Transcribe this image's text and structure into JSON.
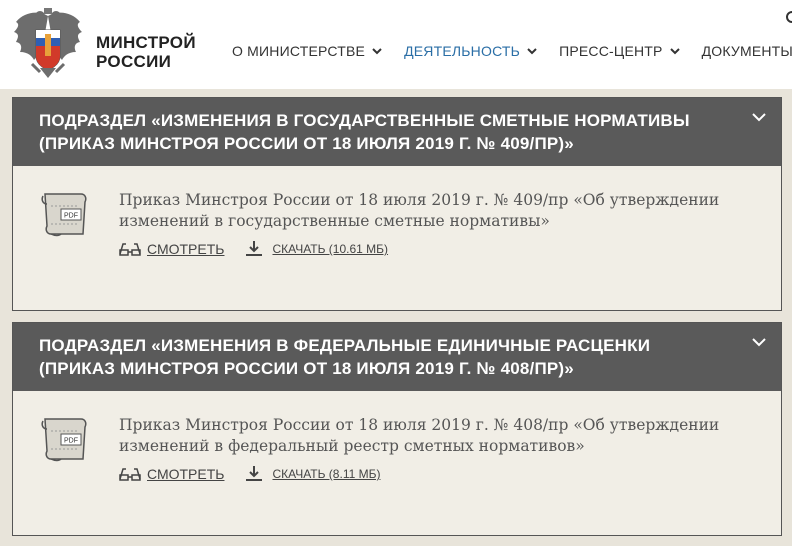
{
  "header": {
    "brand_line1": "МИНСТРОЙ",
    "brand_line2": "РОССИИ",
    "nav": [
      {
        "label": "О МИНИСТЕРСТВЕ",
        "active": false
      },
      {
        "label": "ДЕЯТЕЛЬНОСТЬ",
        "active": true
      },
      {
        "label": "ПРЕСС-ЦЕНТР",
        "active": false
      },
      {
        "label": "ДОКУМЕНТЫ",
        "active": false
      }
    ]
  },
  "colors": {
    "accent": "#2a6ea6",
    "panel_header": "#5a5a5a",
    "panel_body": "#f1eee6",
    "page_bg": "#e8e4da"
  },
  "panels": [
    {
      "title": "ПОДРАЗДЕЛ «ИЗМЕНЕНИЯ В ГОСУДАРСТВЕННЫЕ СМЕТНЫЕ НОРМАТИВЫ (ПРИКАЗ МИНСТРОЯ РОССИИ ОТ 18 ИЮЛЯ 2019 Г. № 409/ПР)»",
      "doc_title": "Приказ Минстроя России от 18 июля 2019 г. № 409/пр «Об утверждении изменений в государственные сметные нормативы»",
      "view_label": "СМОТРЕТЬ",
      "download_label": "СКАЧАТЬ (10.61 МБ)",
      "icon": "pdf-scroll-icon"
    },
    {
      "title": "ПОДРАЗДЕЛ «ИЗМЕНЕНИЯ В ФЕДЕРАЛЬНЫЕ ЕДИНИЧНЫЕ РАСЦЕНКИ (ПРИКАЗ МИНСТРОЯ РОССИИ ОТ 18 ИЮЛЯ 2019 Г. № 408/ПР)»",
      "doc_title": "Приказ Минстроя России от 18 июля 2019 г. № 408/пр «Об утверждении изменений в федеральный реестр сметных нормативов»",
      "view_label": "СМОТРЕТЬ",
      "download_label": "СКАЧАТЬ (8.11 МБ)",
      "icon": "pdf-scroll-icon"
    }
  ],
  "pdf_label": "PDF"
}
